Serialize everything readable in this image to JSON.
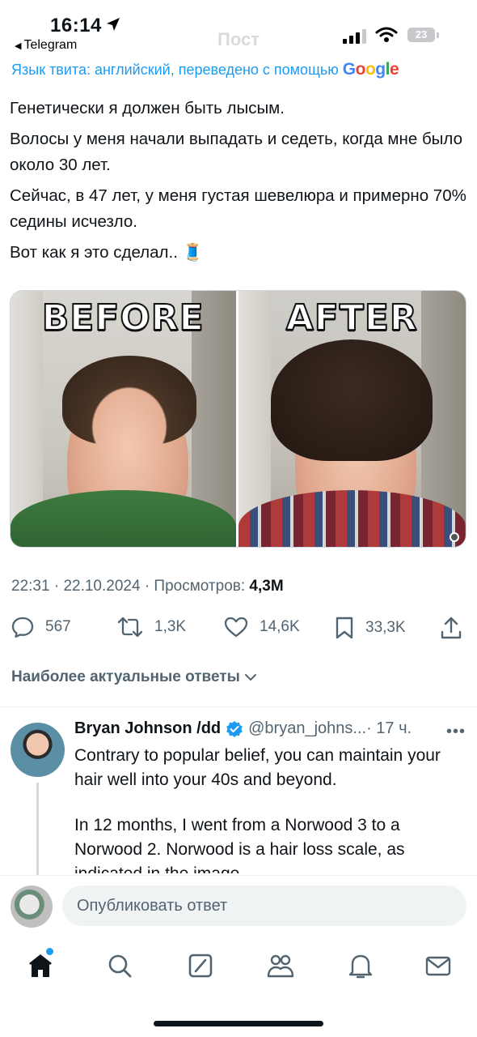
{
  "status_bar": {
    "time": "16:14",
    "back_app": "Telegram",
    "battery": "23"
  },
  "header": {
    "title": "Пост"
  },
  "translation": {
    "text": "Язык твита: английский, переведено с помощью",
    "provider": "Google"
  },
  "tweet": {
    "paragraphs": [
      "Генетически я должен быть лысым.",
      "Волосы у меня начали выпадать и седеть, когда мне было около 30 лет.",
      "Сейчас, в 47 лет, у меня густая шевелюра и примерно 70% седины исчезло.",
      "Вот как я это сделал.. 🧵"
    ],
    "media": {
      "before_label": "BEFORE",
      "after_label": "AFTER"
    },
    "meta": {
      "time": "22:31",
      "date": "22.10.2024",
      "views_label": "Просмотров:",
      "views": "4,3M"
    },
    "actions": {
      "replies": "567",
      "retweets": "1,3K",
      "likes": "14,6K",
      "bookmarks": "33,3K"
    }
  },
  "replies_filter": {
    "label": "Наиболее актуальные ответы"
  },
  "reply": {
    "name": "Bryan Johnson /dd",
    "handle": "@bryan_johns...",
    "age": "· 17 ч.",
    "paragraphs": [
      "Contrary to popular belief, you can maintain your hair well into your 40s and beyond.",
      "In 12 months, I went from a Norwood 3 to a Norwood 2. Norwood is a hair loss scale, as indicated in the image"
    ]
  },
  "compose": {
    "placeholder": "Опубликовать ответ"
  },
  "tab_bar": {
    "items": [
      "home-icon",
      "search-icon",
      "grok-icon",
      "communities-icon",
      "notifications-icon",
      "messages-icon"
    ]
  },
  "colors": {
    "accent": "#1d9bf0",
    "text_primary": "#0f1419",
    "text_secondary": "#536471"
  }
}
